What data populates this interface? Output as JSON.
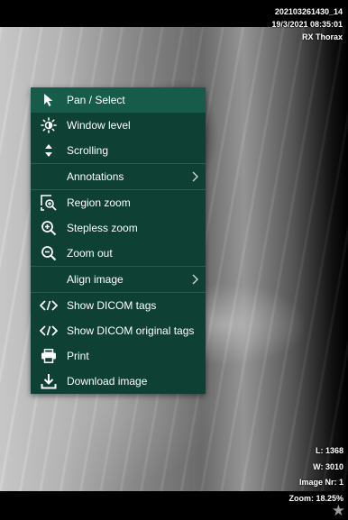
{
  "study": {
    "id": "202103261430_14",
    "datetime": "19/3/2021 08:35:01",
    "description": "RX Thorax"
  },
  "overlay": {
    "level": "L: 1368",
    "width": "W: 3010",
    "image_nr": "Image Nr: 1",
    "zoom": "Zoom: 18.25%"
  },
  "menu": {
    "items": [
      {
        "label": "Pan / Select",
        "icon": "cursor-arrow-icon"
      },
      {
        "label": "Window level",
        "icon": "brightness-sun-icon"
      },
      {
        "label": "Scrolling",
        "icon": "up-down-arrows-icon"
      },
      {
        "label": "Annotations",
        "icon": "",
        "submenu": true
      },
      {
        "label": "Region zoom",
        "icon": "region-zoom-icon"
      },
      {
        "label": "Stepless zoom",
        "icon": "zoom-in-icon"
      },
      {
        "label": "Zoom out",
        "icon": "zoom-out-icon"
      },
      {
        "label": "Align image",
        "icon": "",
        "submenu": true
      },
      {
        "label": "Show DICOM tags",
        "icon": "code-brackets-icon"
      },
      {
        "label": "Show DICOM original tags",
        "icon": "code-brackets-icon"
      },
      {
        "label": "Print",
        "icon": "printer-icon"
      },
      {
        "label": "Download image",
        "icon": "download-icon"
      }
    ]
  },
  "colors": {
    "menu_bg": "#0f4034",
    "menu_active": "#175b4b",
    "separator": "#2a5c50"
  }
}
